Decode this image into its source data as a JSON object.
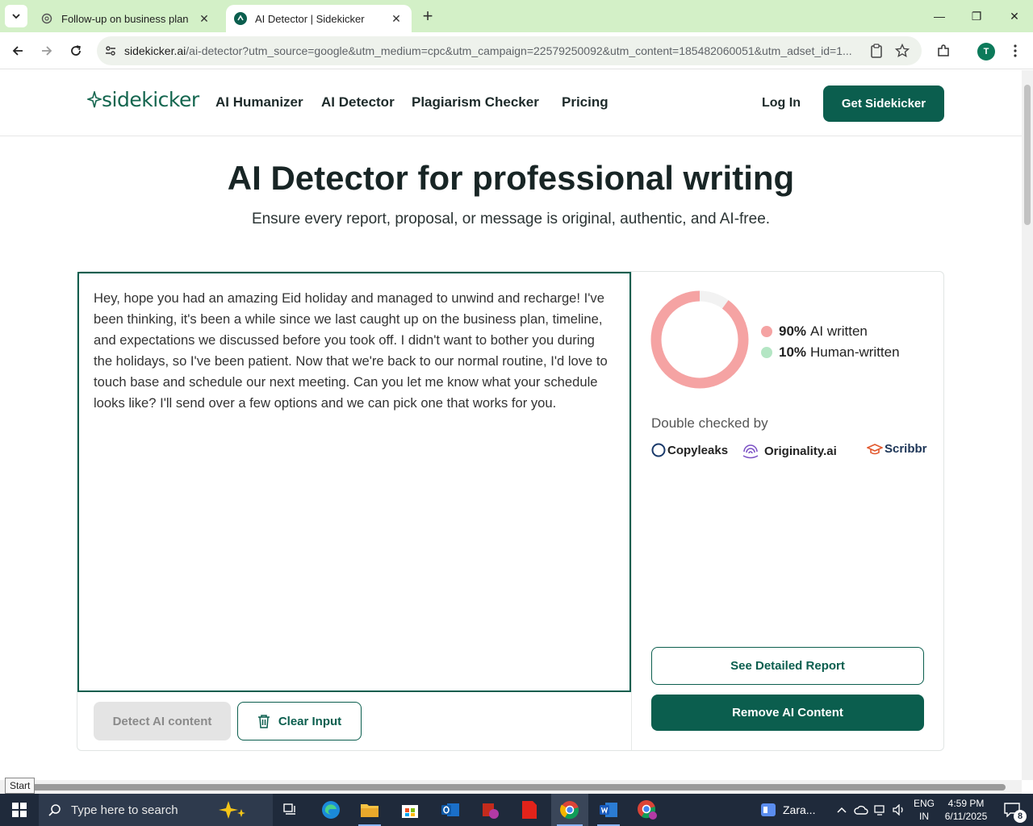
{
  "browser": {
    "tabs": [
      {
        "title": "Follow-up on business plan",
        "active": false
      },
      {
        "title": "AI Detector | Sidekicker",
        "active": true
      }
    ],
    "url_host": "sidekicker.ai",
    "url_path": "/ai-detector?utm_source=google&utm_medium=cpc&utm_campaign=22579250092&utm_content=185482060051&utm_adset_id=1...",
    "profile_initial": "T"
  },
  "site": {
    "logo_text": "sidekicker",
    "nav": [
      "AI Humanizer",
      "AI Detector",
      "Plagiarism Checker",
      "Pricing"
    ],
    "login_label": "Log In",
    "cta_label": "Get Sidekicker",
    "brand_color": "#0b5e4e"
  },
  "hero": {
    "title": "AI Detector for professional writing",
    "subtitle": "Ensure every report, proposal, or message is original, authentic, and AI-free."
  },
  "editor": {
    "text": "Hey, hope you had an amazing Eid holiday and managed to unwind and recharge! I've been thinking, it's been a while since we last caught up on the business plan, timeline, and expectations we discussed before you took off. I didn't want to bother you during the holidays, so I've been patient. Now that we're back to our normal routine, I'd love to touch base and schedule our next meeting. Can you let me know what your schedule looks like? I'll send over a few options and we can pick one that works for you."
  },
  "actions": {
    "detect_label": "Detect AI content",
    "clear_label": "Clear Input"
  },
  "result": {
    "ai_percent": 90,
    "human_percent": 10,
    "ai_pct_label": "90%",
    "ai_label": "AI written",
    "human_pct_label": "10%",
    "human_label": "Human-written",
    "ai_color": "#f5a3a3",
    "human_color": "#b4e6c4",
    "double_checked_label": "Double checked by",
    "partners": [
      "Copyleaks",
      "Originality.ai",
      "Scribbr"
    ],
    "report_label": "See Detailed Report",
    "remove_label": "Remove AI Content"
  },
  "os": {
    "start_tooltip": "Start",
    "search_placeholder": "Type here to search",
    "weather_label": "Zara...",
    "lang_1": "ENG",
    "lang_2": "IN",
    "time": "4:59 PM",
    "date": "6/11/2025",
    "notifications": "8"
  }
}
